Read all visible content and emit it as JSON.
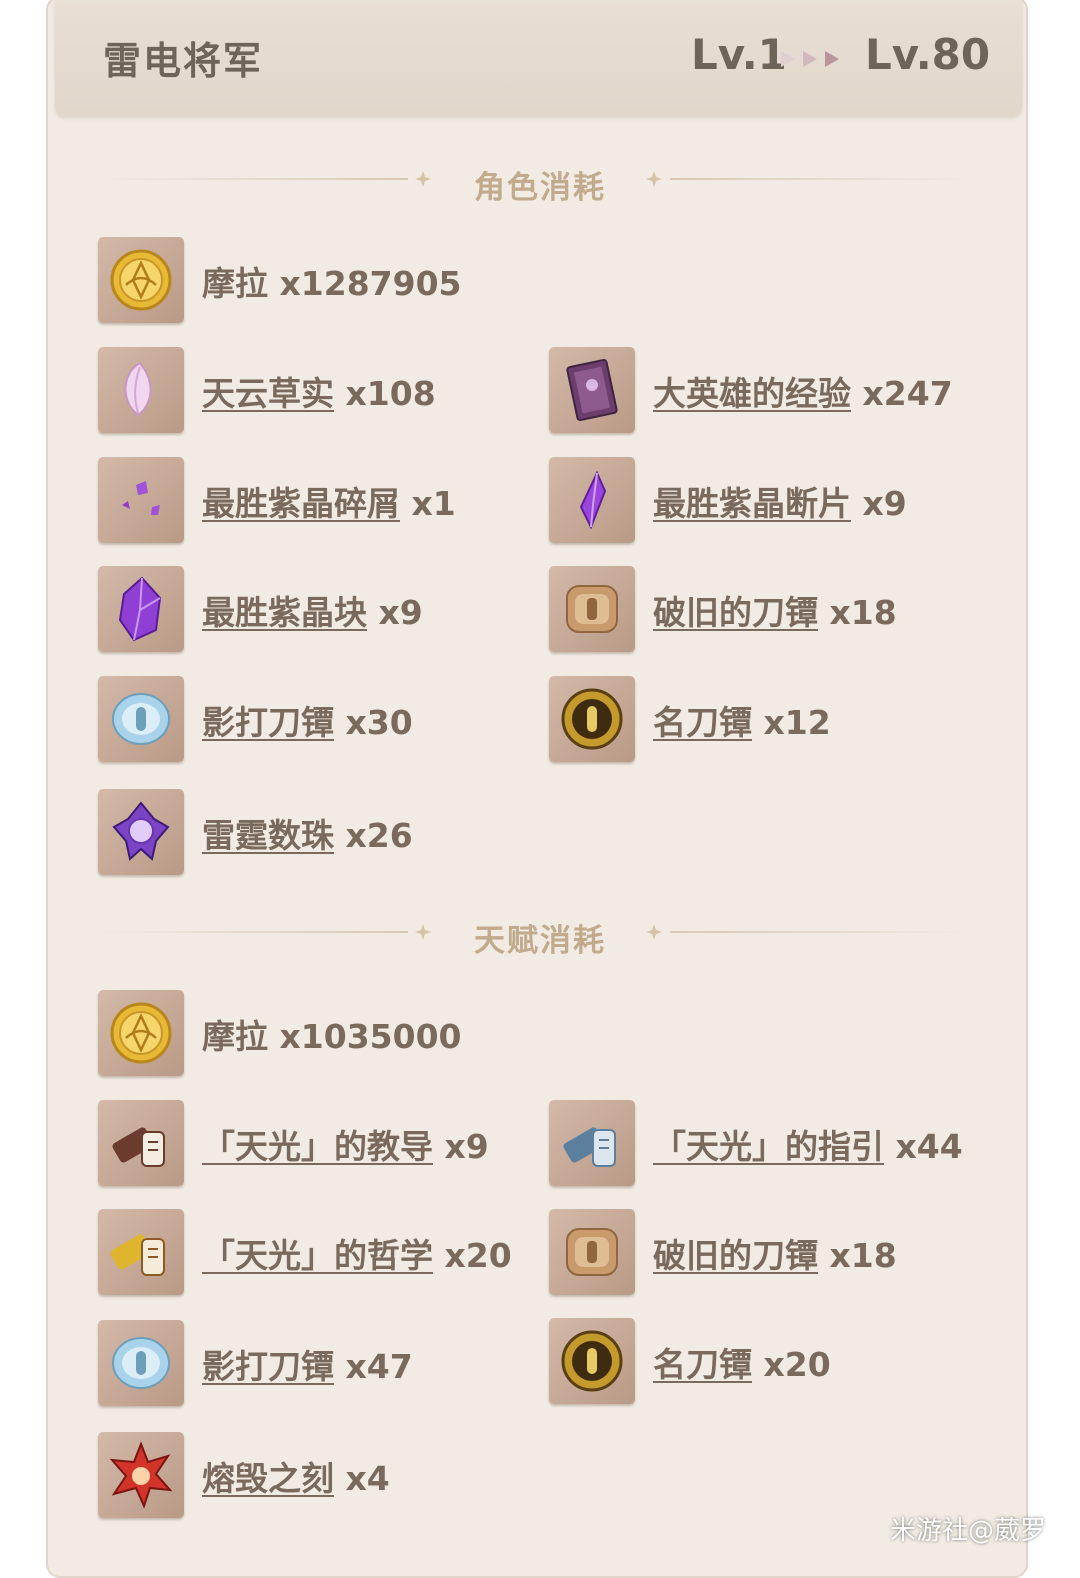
{
  "header": {
    "character": "雷电将军",
    "level_from": "Lv.1",
    "level_to": "Lv.80"
  },
  "sections": {
    "character_title": "角色消耗",
    "talent_title": "天赋消耗"
  },
  "character_items": [
    {
      "name": "摩拉",
      "qty": "x1287905",
      "icon": "mora-coin-icon"
    },
    {
      "name": "天云草实",
      "qty": "x108",
      "icon": "amakumo-fruit-icon"
    },
    {
      "name": "大英雄的经验",
      "qty": "x247",
      "icon": "heros-wit-book-icon"
    },
    {
      "name": "最胜紫晶碎屑",
      "qty": "x1",
      "icon": "amethyst-sliver-icon"
    },
    {
      "name": "最胜紫晶断片",
      "qty": "x9",
      "icon": "amethyst-fragment-icon"
    },
    {
      "name": "最胜紫晶块",
      "qty": "x9",
      "icon": "amethyst-chunk-icon"
    },
    {
      "name": "破旧的刀镡",
      "qty": "x18",
      "icon": "old-handguard-icon"
    },
    {
      "name": "影打刀镡",
      "qty": "x30",
      "icon": "kageuchi-handguard-icon"
    },
    {
      "name": "名刀镡",
      "qty": "x12",
      "icon": "famed-handguard-icon"
    },
    {
      "name": "雷霆数珠",
      "qty": "x26",
      "icon": "storm-beads-icon"
    }
  ],
  "talent_items": [
    {
      "name": "摩拉",
      "qty": "x1035000",
      "icon": "mora-coin-icon"
    },
    {
      "name": "「天光」的教导",
      "qty": "x9",
      "icon": "light-teachings-scroll-icon"
    },
    {
      "name": "「天光」的指引",
      "qty": "x44",
      "icon": "light-guide-scroll-icon"
    },
    {
      "name": "「天光」的哲学",
      "qty": "x20",
      "icon": "light-philosophies-scroll-icon"
    },
    {
      "name": "破旧的刀镡",
      "qty": "x18",
      "icon": "old-handguard-icon"
    },
    {
      "name": "影打刀镡",
      "qty": "x47",
      "icon": "kageuchi-handguard-icon"
    },
    {
      "name": "名刀镡",
      "qty": "x20",
      "icon": "famed-handguard-icon"
    },
    {
      "name": "熔毁之刻",
      "qty": "x4",
      "icon": "molten-moment-icon"
    }
  ],
  "watermark": "米游社@葳罗"
}
